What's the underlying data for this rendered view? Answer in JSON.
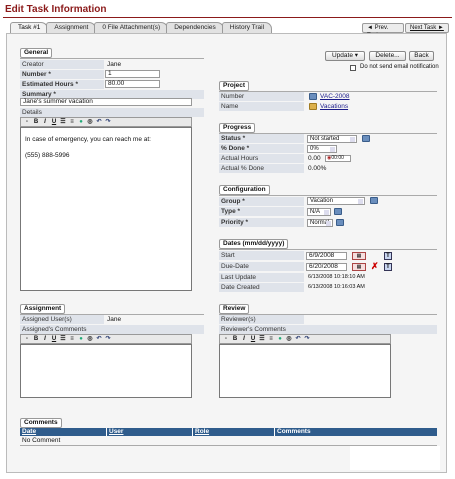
{
  "page_title": "Edit Task Information",
  "tabs": [
    "Task #1",
    "Assignment",
    "0 File Attachment(s)",
    "Dependencies",
    "History Trail"
  ],
  "nav": {
    "prev": "◄ Prev. Task",
    "next": "Next Task ►"
  },
  "actions": {
    "update": "Update",
    "delete": "Delete...",
    "back": "Back",
    "no_email": "Do not send email notification"
  },
  "general": {
    "header": "General",
    "creator_label": "Creator",
    "creator": "Jane",
    "number_label": "Number *",
    "number": "1",
    "hours_label": "Estimated Hours *",
    "hours": "80.00",
    "summary_label": "Summary *",
    "summary": "Jane's summer vacation",
    "details_label": "Details",
    "details_line1": "In case of emergency, you can reach me at:",
    "details_line2": "(555) 888-5996"
  },
  "project": {
    "header": "Project",
    "number_label": "Number",
    "number": "VAC-2008",
    "name_label": "Name",
    "name": "Vacations"
  },
  "progress": {
    "header": "Progress",
    "status_label": "Status *",
    "status": "Not started",
    "done_label": "% Done *",
    "done": "0%",
    "actual_hours_label": "Actual Hours",
    "actual_hours": "0.00",
    "timer": "00:00",
    "actual_done_label": "Actual % Done",
    "actual_done": "0.00%"
  },
  "configuration": {
    "header": "Configuration",
    "group_label": "Group *",
    "group": "Vacation",
    "type_label": "Type *",
    "type": "N/A",
    "priority_label": "Priority *",
    "priority": "Normal"
  },
  "dates": {
    "header": "Dates (mm/dd/yyyy)",
    "start_label": "Start",
    "start": "6/9/2008",
    "due_label": "Due-Date",
    "due": "6/20/2008",
    "last_update_label": "Last Update",
    "last_update": "6/13/2008 10:18:10 AM",
    "created_label": "Date Created",
    "created": "6/13/2008 10:16:03 AM"
  },
  "assignment": {
    "header": "Assignment",
    "users_label": "Assigned User(s)",
    "users": "Jane",
    "comments_label": "Assigned's Comments"
  },
  "review": {
    "header": "Review",
    "reviewers_label": "Reviewer(s)",
    "reviewers": "",
    "comments_label": "Reviewer's Comments"
  },
  "comments": {
    "header": "Comments",
    "columns": [
      "Date",
      "User",
      "Role",
      "Comments"
    ],
    "empty": "No Comment"
  },
  "toolbar": {
    "bold": "B",
    "italic": "I",
    "underline": "U"
  },
  "colors": {
    "title": "#8b1a1a",
    "label_bg": "#dfe3ea",
    "table_header": "#2f5c8c"
  }
}
